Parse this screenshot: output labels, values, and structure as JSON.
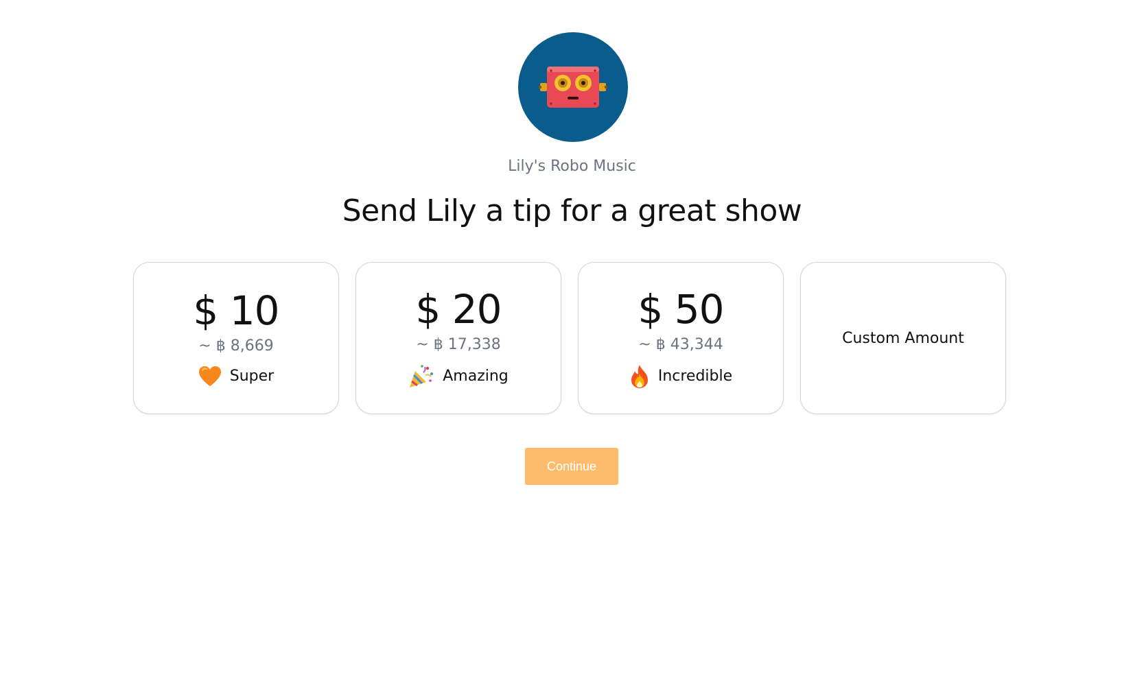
{
  "creator": {
    "name": "Lily's Robo Music",
    "avatar_icon": "robot-face-icon",
    "avatar_bg": "#0a5c8c"
  },
  "page_title": "Send Lily a tip for a great show",
  "tip_options": [
    {
      "amount": "$ 10",
      "btc": "~ ฿ 8,669",
      "label": "Super",
      "icon": "orange-heart-icon"
    },
    {
      "amount": "$ 20",
      "btc": "~ ฿ 17,338",
      "label": "Amazing",
      "icon": "party-popper-icon"
    },
    {
      "amount": "$ 50",
      "btc": "~ ฿ 43,344",
      "label": "Incredible",
      "icon": "fire-icon"
    }
  ],
  "custom_amount_label": "Custom Amount",
  "continue_button": {
    "label": "Continue",
    "color": "#fdbb6b"
  }
}
